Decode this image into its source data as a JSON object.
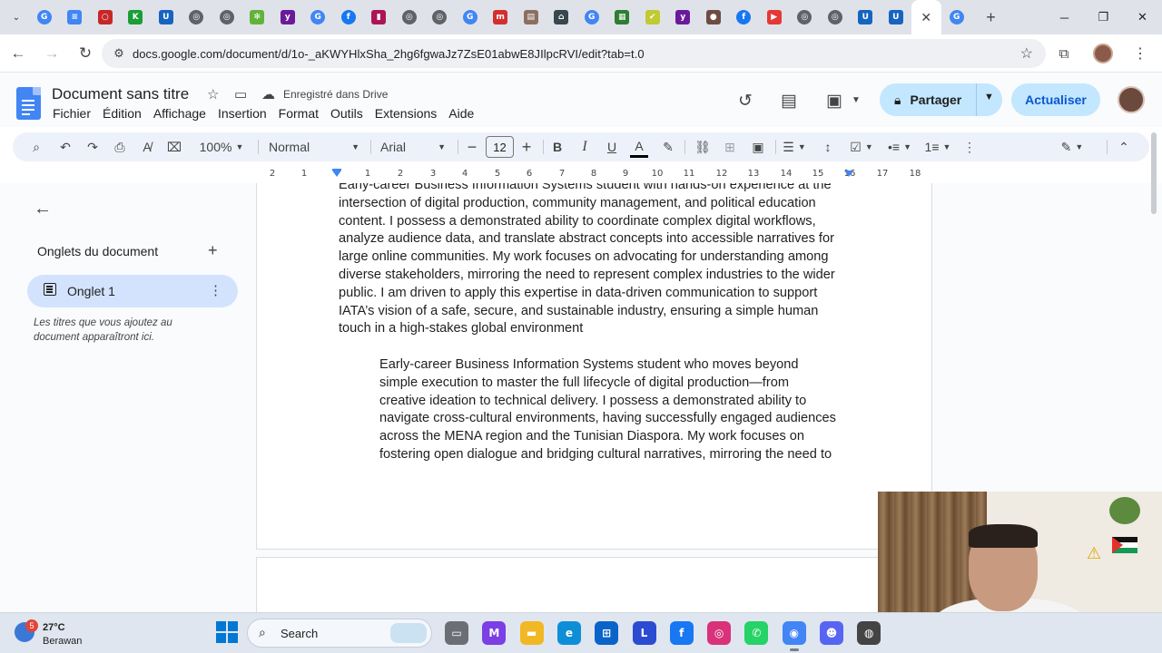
{
  "browser": {
    "tabs": [
      {
        "icon": "google-icon",
        "color": "#4285f4",
        "glyph": "G"
      },
      {
        "icon": "docs-icon",
        "color": "#4285f4",
        "glyph": "≡"
      },
      {
        "icon": "app-icon",
        "color": "#c62828",
        "glyph": "○"
      },
      {
        "icon": "kahoot-icon",
        "color": "#1b9e36",
        "glyph": "K"
      },
      {
        "icon": "uni-icon",
        "color": "#1565c0",
        "glyph": "U"
      },
      {
        "icon": "globe-icon",
        "color": "#5f6368",
        "glyph": "◎"
      },
      {
        "icon": "globe-icon",
        "color": "#5f6368",
        "glyph": "◎"
      },
      {
        "icon": "slack-icon",
        "color": "#62b33a",
        "glyph": "✻"
      },
      {
        "icon": "yahoo-icon",
        "color": "#6a1b9a",
        "glyph": "y"
      },
      {
        "icon": "google-icon",
        "color": "#4285f4",
        "glyph": "G"
      },
      {
        "icon": "facebook-icon",
        "color": "#1877f2",
        "glyph": "f"
      },
      {
        "icon": "app-icon",
        "color": "#ad1457",
        "glyph": "▮"
      },
      {
        "icon": "globe-icon",
        "color": "#5f6368",
        "glyph": "◎"
      },
      {
        "icon": "globe-icon",
        "color": "#5f6368",
        "glyph": "◎"
      },
      {
        "icon": "google-icon",
        "color": "#4285f4",
        "glyph": "G"
      },
      {
        "icon": "app-icon",
        "color": "#d32f2f",
        "glyph": "m"
      },
      {
        "icon": "app-icon",
        "color": "#8d6e63",
        "glyph": "▤"
      },
      {
        "icon": "app-icon",
        "color": "#37474f",
        "glyph": "⌂"
      },
      {
        "icon": "google-icon",
        "color": "#4285f4",
        "glyph": "G"
      },
      {
        "icon": "app-icon",
        "color": "#2e7d32",
        "glyph": "▦"
      },
      {
        "icon": "app-icon",
        "color": "#c0ca33",
        "glyph": "✔"
      },
      {
        "icon": "yahoo-icon",
        "color": "#6a1b9a",
        "glyph": "y"
      },
      {
        "icon": "app-icon",
        "color": "#6d4c41",
        "glyph": "●"
      },
      {
        "icon": "facebook-icon",
        "color": "#1877f2",
        "glyph": "f"
      },
      {
        "icon": "app-icon",
        "color": "#e53935",
        "glyph": "▶"
      },
      {
        "icon": "globe-icon",
        "color": "#5f6368",
        "glyph": "◎"
      },
      {
        "icon": "globe-icon",
        "color": "#5f6368",
        "glyph": "◎"
      },
      {
        "icon": "uni-icon",
        "color": "#1565c0",
        "glyph": "U"
      },
      {
        "icon": "uni-icon",
        "color": "#1565c0",
        "glyph": "U"
      },
      {
        "icon": "close-icon",
        "color": "#ffffff",
        "glyph": "✕",
        "active": true
      },
      {
        "icon": "google-icon",
        "color": "#4285f4",
        "glyph": "G"
      }
    ],
    "url": "docs.google.com/document/d/1o-_aKWYHlxSha_2hg6fgwaJz7ZsE01abwE8JIlpcRVI/edit?tab=t.0"
  },
  "docs": {
    "title": "Document sans titre",
    "saved_status": "Enregistré dans Drive",
    "menu": [
      "Fichier",
      "Édition",
      "Affichage",
      "Insertion",
      "Format",
      "Outils",
      "Extensions",
      "Aide"
    ],
    "share_label": "Partager",
    "update_label": "Actualiser",
    "toolbar": {
      "zoom": "100%",
      "style": "Normal",
      "font": "Arial",
      "font_size": "12"
    },
    "ruler_numbers": [
      "2",
      "1",
      "1",
      "2",
      "3",
      "4",
      "5",
      "6",
      "7",
      "8",
      "9",
      "10",
      "11",
      "12",
      "13",
      "14",
      "15",
      "16",
      "17",
      "18"
    ],
    "sidebar": {
      "heading": "Onglets du document",
      "tab_label": "Onglet 1",
      "hint": "Les titres que vous ajoutez au document apparaîtront ici."
    },
    "paragraphs": [
      "Early-career Business Information Systems student with hands-on experience at the\nintersection of digital production, community management, and political education\ncontent. I possess a demonstrated ability to coordinate complex digital workflows,\nanalyze audience data, and translate abstract concepts into accessible narratives for\nlarge online communities. My work focuses on advocating for understanding among\ndiverse stakeholders, mirroring the need to represent complex industries to the wider\npublic. I am driven to apply this expertise in data-driven communication to support\nIATA’s vision of a safe, secure, and sustainable industry, ensuring a simple human\ntouch in a high-stakes global environment",
      "Early-career Business Information Systems student who moves beyond\nsimple execution to master the full lifecycle of digital production—from\ncreative ideation to technical delivery. I possess a demonstrated ability to\nnavigate cross-cultural environments, having successfully engaged audiences\nacross the MENA region and the Tunisian Diaspora. My work focuses on\nfostering open dialogue and bridging cultural narratives, mirroring the need to"
    ]
  },
  "taskbar": {
    "weather_temp": "27°C",
    "weather_desc": "Berawan",
    "weather_badge": "5",
    "search_label": "Search",
    "apps": [
      {
        "name": "file-explorer-icon",
        "color": "#6b6f75",
        "glyph": "▭"
      },
      {
        "name": "m365-icon",
        "color": "#7b3fe4",
        "glyph": "M"
      },
      {
        "name": "folder-icon",
        "color": "#f2b824",
        "glyph": "▬"
      },
      {
        "name": "edge-icon",
        "color": "#0f8ed8",
        "glyph": "e"
      },
      {
        "name": "store-icon",
        "color": "#0a63c9",
        "glyph": "⊞"
      },
      {
        "name": "app-l-icon",
        "color": "#2b4bd1",
        "glyph": "L"
      },
      {
        "name": "facebook-icon",
        "color": "#1877f2",
        "glyph": "f"
      },
      {
        "name": "instagram-icon",
        "color": "#d9317a",
        "glyph": "◎"
      },
      {
        "name": "whatsapp-icon",
        "color": "#25d366",
        "glyph": "✆"
      },
      {
        "name": "chrome-icon",
        "color": "#4285f4",
        "glyph": "◉",
        "active": true
      },
      {
        "name": "discord-icon",
        "color": "#5865f2",
        "glyph": "☻"
      },
      {
        "name": "app-icon",
        "color": "#444444",
        "glyph": "◍"
      }
    ]
  }
}
